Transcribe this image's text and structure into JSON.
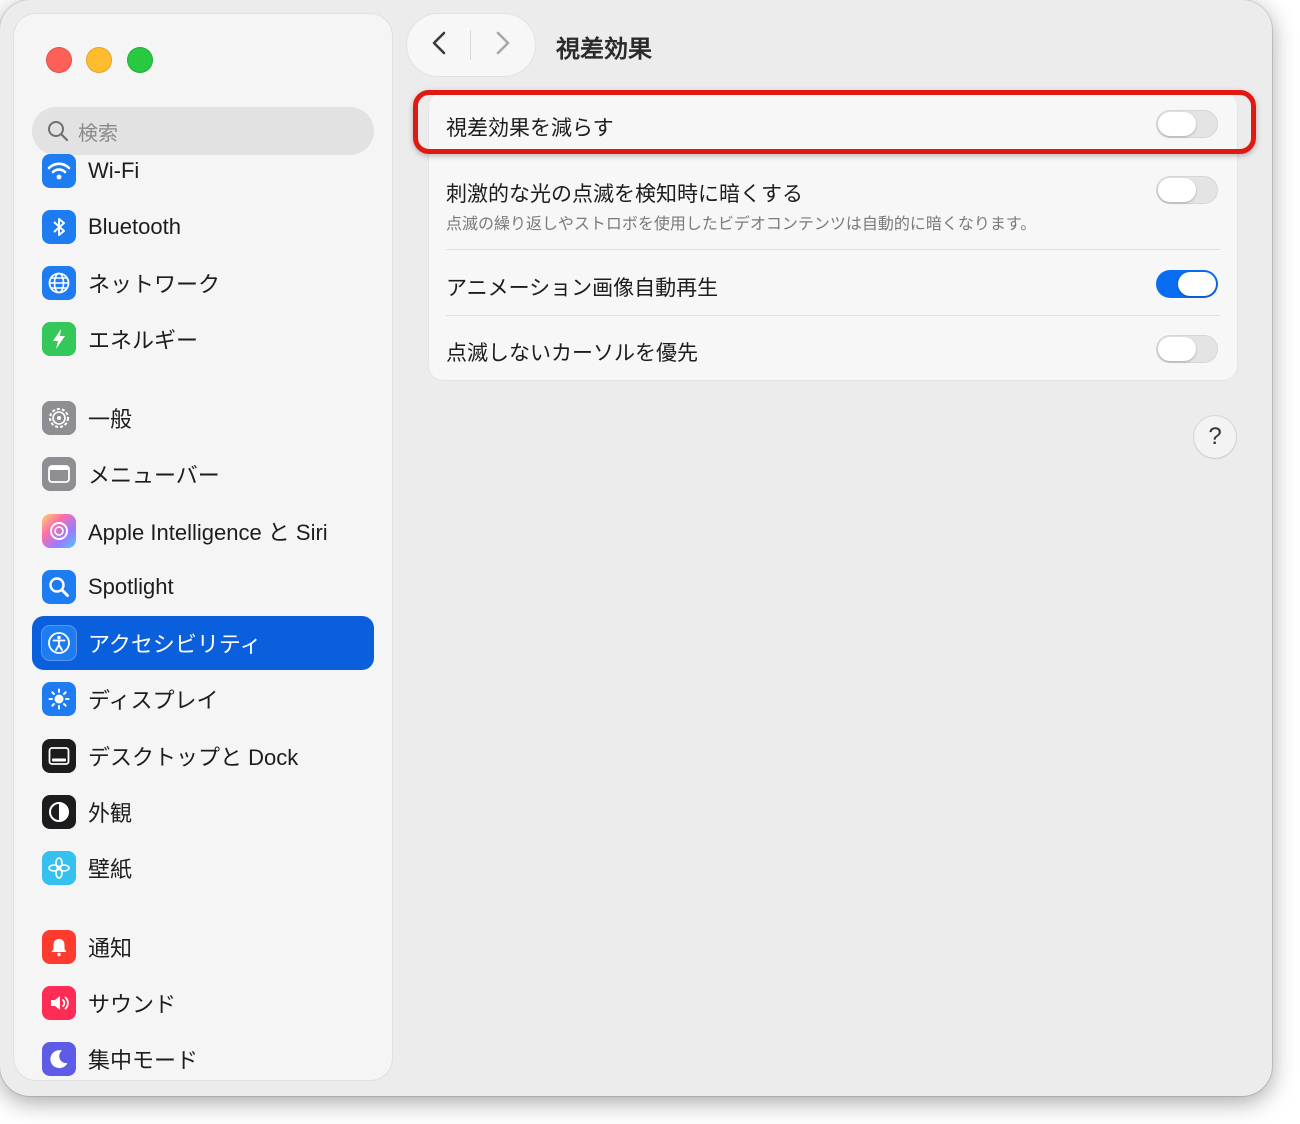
{
  "window": {
    "page_title": "視差効果"
  },
  "search": {
    "placeholder": "検索"
  },
  "sidebar": {
    "items": [
      {
        "label": "Wi-Fi",
        "icon": "wifi-icon",
        "color": "#1e7cf2"
      },
      {
        "label": "Bluetooth",
        "icon": "bluetooth-icon",
        "color": "#1e7cf2"
      },
      {
        "label": "ネットワーク",
        "icon": "globe-icon",
        "color": "#1e7cf2"
      },
      {
        "label": "エネルギー",
        "icon": "bolt-icon",
        "color": "#34c759"
      },
      {
        "label": "一般",
        "icon": "gear-icon",
        "color": "#8e8e93"
      },
      {
        "label": "メニューバー",
        "icon": "menubar-icon",
        "color": "#8e8e93"
      },
      {
        "label": "Apple Intelligence と Siri",
        "icon": "siri-icon",
        "color": "#c86dd7"
      },
      {
        "label": "Spotlight",
        "icon": "magnifier-icon",
        "color": "#1e7cf2"
      },
      {
        "label": "アクセシビリティ",
        "icon": "accessibility-icon",
        "color": "#1e7cf2",
        "selected": true
      },
      {
        "label": "ディスプレイ",
        "icon": "sun-icon",
        "color": "#1e7cf2"
      },
      {
        "label": "デスクトップと Dock",
        "icon": "dock-icon",
        "color": "#1c1c1e"
      },
      {
        "label": "外観",
        "icon": "appearance-icon",
        "color": "#1c1c1e"
      },
      {
        "label": "壁紙",
        "icon": "flower-icon",
        "color": "#35c1f0"
      },
      {
        "label": "通知",
        "icon": "bell-icon",
        "color": "#ff3b30"
      },
      {
        "label": "サウンド",
        "icon": "speaker-icon",
        "color": "#ff2d55"
      },
      {
        "label": "集中モード",
        "icon": "moon-icon",
        "color": "#5e5ce6"
      }
    ]
  },
  "settings": {
    "rows": [
      {
        "title": "視差効果を減らす",
        "subtitle": "",
        "on": false,
        "highlighted": true
      },
      {
        "title": "刺激的な光の点滅を検知時に暗くする",
        "subtitle": "点滅の繰り返しやストロボを使用したビデオコンテンツは自動的に暗くなります。",
        "on": false
      },
      {
        "title": "アニメーション画像自動再生",
        "subtitle": "",
        "on": true
      },
      {
        "title": "点滅しないカーソルを優先",
        "subtitle": "",
        "on": false
      }
    ]
  },
  "help": {
    "label": "?"
  },
  "colors": {
    "accent": "#0a5fdc",
    "toggle_on": "#0a6cf0",
    "highlight_border": "#e01a12"
  }
}
